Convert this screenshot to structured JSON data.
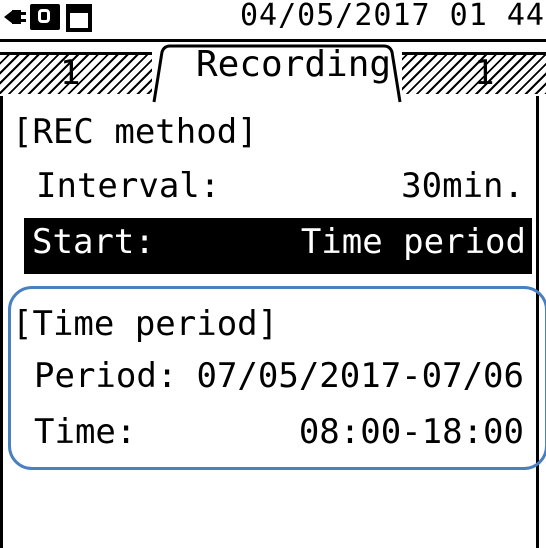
{
  "status_bar": {
    "icons": [
      "plug-icon",
      "usb-icon",
      "memory-card-icon"
    ],
    "datetime": "04/05/2017 01 44"
  },
  "tabs": {
    "left_label": "1",
    "active_label": "Recording",
    "right_label": "1"
  },
  "rec_method": {
    "heading": "[REC method]",
    "interval_label": "Interval:",
    "interval_value": "30min.",
    "start_label": "Start:",
    "start_value": "Time period"
  },
  "time_period": {
    "heading": "[Time period]",
    "period_label": "Period:",
    "period_value": "07/05/2017-07/06",
    "time_label": "Time:",
    "time_value": "08:00-18:00"
  },
  "colors": {
    "screen_bg": "#ffffff",
    "text": "#000000",
    "selected_bg": "#000000",
    "selected_text": "#ffffff",
    "annotation_box": "#4a7fc0"
  }
}
